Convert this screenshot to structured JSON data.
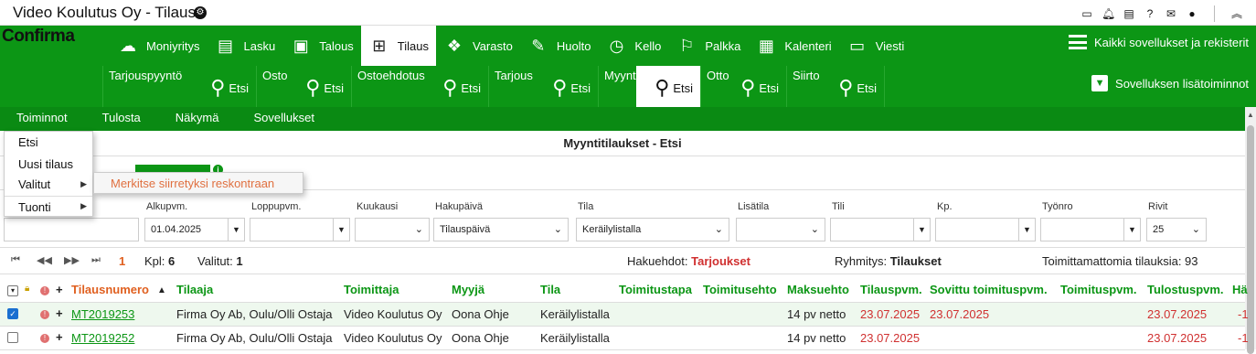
{
  "window": {
    "title": "Video Koulutus Oy - Tilaus"
  },
  "brand": {
    "logo": "Confirma"
  },
  "app_nav": [
    {
      "label": "Moniyritys",
      "icon": "cloud-upload-icon",
      "glyph": "☁"
    },
    {
      "label": "Lasku",
      "icon": "document-icon",
      "glyph": "▤"
    },
    {
      "label": "Talous",
      "icon": "money-icon",
      "glyph": "▣"
    },
    {
      "label": "Tilaus",
      "icon": "table-icon",
      "glyph": "⊞",
      "active": true
    },
    {
      "label": "Varasto",
      "icon": "boxes-icon",
      "glyph": "❖"
    },
    {
      "label": "Huolto",
      "icon": "wrench-icon",
      "glyph": "✎"
    },
    {
      "label": "Kello",
      "icon": "clock-icon",
      "glyph": "◷"
    },
    {
      "label": "Palkka",
      "icon": "flag-icon",
      "glyph": "⚐"
    },
    {
      "label": "Kalenteri",
      "icon": "calendar-icon",
      "glyph": "▦"
    },
    {
      "label": "Viesti",
      "icon": "inbox-icon",
      "glyph": "▭"
    }
  ],
  "all_apps": {
    "label": "Kaikki sovellukset ja rekisterit"
  },
  "sub_nav": [
    {
      "label": "Tarjouspyyntö",
      "action": "Etsi"
    },
    {
      "label": "Osto",
      "action": "Etsi"
    },
    {
      "label": "Ostoehdotus",
      "action": "Etsi"
    },
    {
      "label": "Tarjous",
      "action": "Etsi"
    },
    {
      "label": "Myynti",
      "action": "Etsi",
      "active": true
    },
    {
      "label": "Otto",
      "action": "Etsi"
    },
    {
      "label": "Siirto",
      "action": "Etsi"
    }
  ],
  "extra_features": {
    "label": "Sovelluksen lisätoiminnot"
  },
  "menubar": [
    "Toiminnot",
    "Tulosta",
    "Näkymä",
    "Sovellukset"
  ],
  "dropdown": {
    "items": [
      "Etsi",
      "Uusi tilaus",
      "Valitut",
      "Tuonti"
    ],
    "submenu": "Merkitse siirretyksi reskontraan"
  },
  "page": {
    "title": "Myyntitilaukset - Etsi"
  },
  "filters": {
    "alkupvm": {
      "label": "Alkupvm.",
      "value": "01.04.2025"
    },
    "loppupvm": {
      "label": "Loppupvm.",
      "value": ""
    },
    "kuukausi": {
      "label": "Kuukausi",
      "value": ""
    },
    "hakupaiva": {
      "label": "Hakupäivä",
      "value": "Tilauspäivä"
    },
    "tila": {
      "label": "Tila",
      "value": "Keräilylistalla"
    },
    "lisatila": {
      "label": "Lisätila",
      "value": ""
    },
    "tili": {
      "label": "Tili",
      "value": ""
    },
    "kp": {
      "label": "Kp.",
      "value": ""
    },
    "tyonro": {
      "label": "Työnro",
      "value": ""
    },
    "rivit": {
      "label": "Rivit",
      "value": "25"
    }
  },
  "pager": {
    "page": "1",
    "count_label": "Kpl:",
    "count": "6",
    "selected_label": "Valitut:",
    "selected": "1",
    "search_label": "Hakuehdot:",
    "search_value": "Tarjoukset",
    "grouping_label": "Ryhmitys:",
    "grouping_value": "Tilaukset",
    "undelivered": "Toimittamattomia tilauksia: 93"
  },
  "columns": [
    "Tilausnumero",
    "Tilaaja",
    "Toimittaja",
    "Myyjä",
    "Tila",
    "Toimitustapa",
    "Toimitusehto",
    "Maksuehto",
    "Tilauspvm.",
    "Sovittu toimituspvm.",
    "Toimituspvm.",
    "Tulostuspvm.",
    "Hä"
  ],
  "rows": [
    {
      "checked": true,
      "number": "MT2019253",
      "customer": "Firma Oy Ab, Oulu/Olli Ostaja",
      "supplier": "Video Koulutus Oy",
      "seller": "Oona Ohje",
      "status": "Keräilylistalla",
      "delivery_method": "",
      "delivery_terms": "",
      "payment_terms": "14 pv netto",
      "order_date": "23.07.2025",
      "agreed_date": "23.07.2025",
      "delivery_date": "",
      "print_date": "23.07.2025",
      "extra": "-1"
    },
    {
      "checked": false,
      "number": "MT2019252",
      "customer": "Firma Oy Ab, Oulu/Olli Ostaja",
      "supplier": "Video Koulutus Oy",
      "seller": "Oona Ohje",
      "status": "Keräilylistalla",
      "delivery_method": "",
      "delivery_terms": "",
      "payment_terms": "14 pv netto",
      "order_date": "23.07.2025",
      "agreed_date": "",
      "delivery_date": "",
      "print_date": "23.07.2025",
      "extra": "-1"
    }
  ],
  "colors": {
    "brand_green": "#0c9615",
    "accent_orange": "#e06020",
    "date_red": "#d03030"
  }
}
